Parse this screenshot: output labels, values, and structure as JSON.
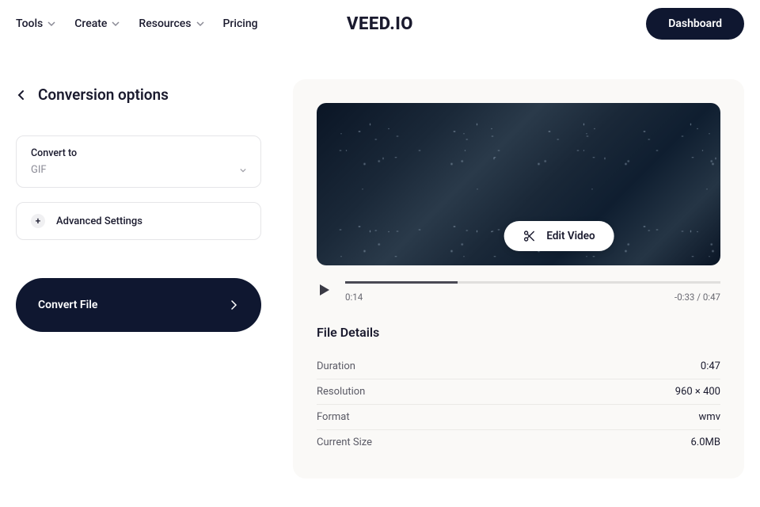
{
  "nav": {
    "tools": "Tools",
    "create": "Create",
    "resources": "Resources",
    "pricing": "Pricing"
  },
  "logo": "VEED.IO",
  "dashboard": "Dashboard",
  "page_title": "Conversion options",
  "convert_to": {
    "label": "Convert to",
    "value": "GIF"
  },
  "advanced_settings": "Advanced Settings",
  "convert_button": "Convert File",
  "edit_video": "Edit Video",
  "player": {
    "current_time": "0:14",
    "remaining_total": "-0:33 / 0:47",
    "progress_percent": 30
  },
  "details": {
    "title": "File Details",
    "rows": [
      {
        "label": "Duration",
        "value": "0:47"
      },
      {
        "label": "Resolution",
        "value": "960 × 400"
      },
      {
        "label": "Format",
        "value": "wmv"
      },
      {
        "label": "Current Size",
        "value": "6.0MB"
      }
    ]
  }
}
